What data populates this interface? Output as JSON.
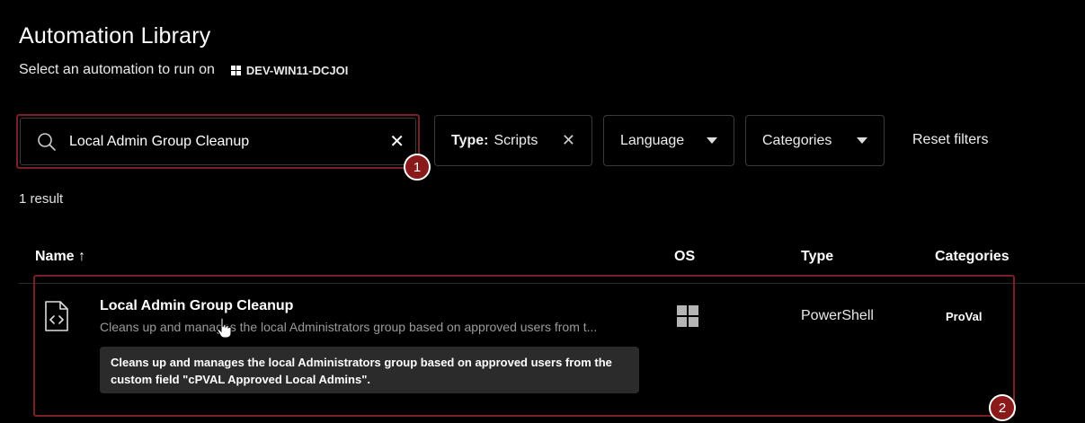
{
  "page": {
    "title": "Automation Library",
    "subtitle": "Select an automation to run on",
    "device_name": "DEV-WIN11-DCJOI"
  },
  "search": {
    "value": "Local Admin Group Cleanup",
    "clear_icon": "close-icon",
    "annotation": "1"
  },
  "filters": {
    "type_label": "Type:",
    "type_value": "Scripts",
    "language_label": "Language",
    "categories_label": "Categories",
    "reset_label": "Reset filters"
  },
  "results": {
    "count_text": "1 result",
    "columns": {
      "name": "Name",
      "sort_indicator": "↑",
      "os": "OS",
      "type": "Type",
      "categories": "Categories"
    },
    "rows": [
      {
        "name": "Local Admin Group Cleanup",
        "description": "Cleans up and manages the local Administrators group based on approved users from t...",
        "tooltip": "Cleans up and manages the local Administrators group based on approved users from the custom field \"cPVAL Approved Local Admins\".",
        "os_icon": "windows-icon",
        "type": "PowerShell",
        "category": "ProVal"
      }
    ],
    "annotation": "2"
  },
  "colors": {
    "background": "#000000",
    "annotation_badge": "#8a1a1a",
    "highlight_border": "#7a1f24",
    "tooltip_bg": "#2b2b2b"
  }
}
